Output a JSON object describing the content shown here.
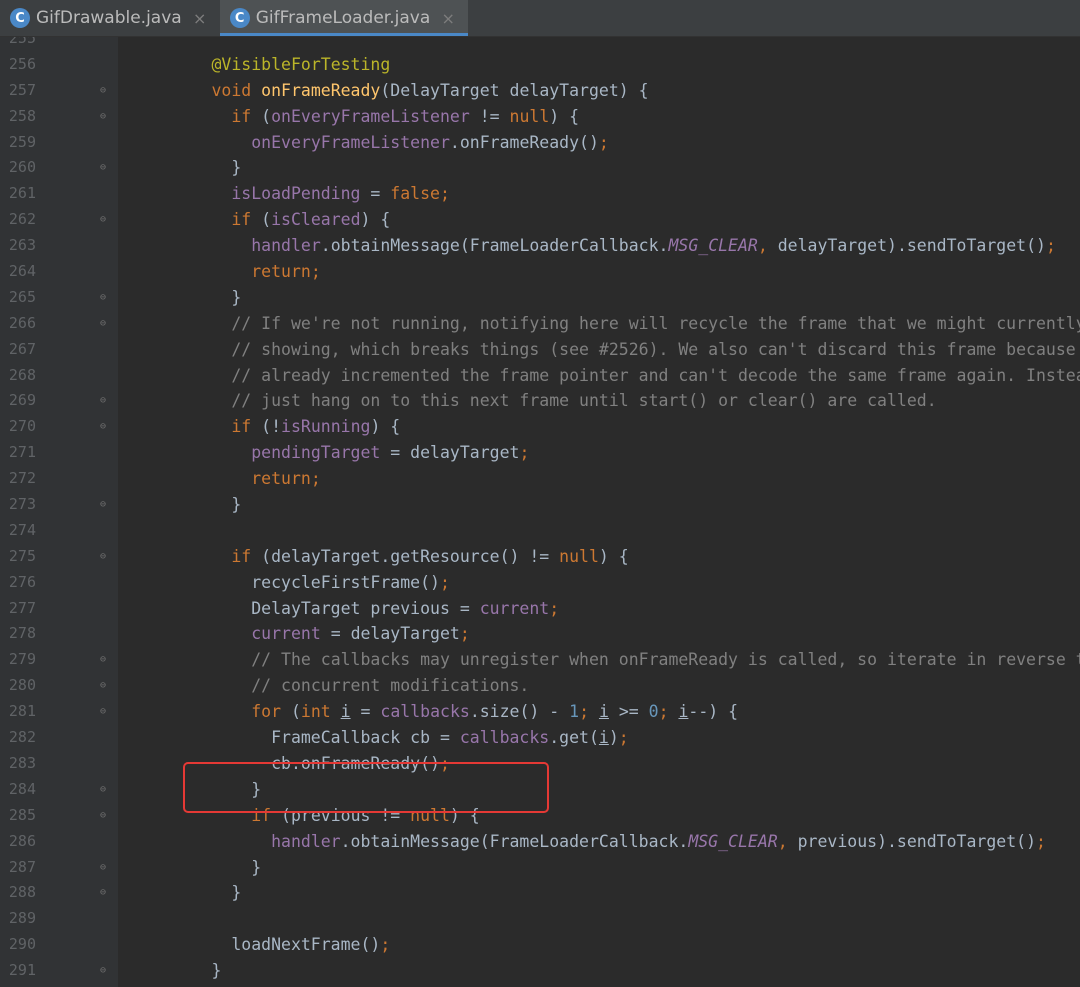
{
  "tabs": [
    {
      "label": "GifDrawable.java",
      "icon": "java-class-icon",
      "icon_glyph": "C",
      "active": false,
      "close": "×"
    },
    {
      "label": "GifFrameLoader.java",
      "icon": "java-class-icon",
      "icon_glyph": "C",
      "active": true,
      "close": "×"
    }
  ],
  "colors": {
    "background": "#2b2b2b",
    "gutter": "#313335",
    "keyword": "#cc7832",
    "annotation": "#bbb529",
    "method_declaration": "#ffc66d",
    "field": "#9876aa",
    "comment": "#808080",
    "number": "#6897bb",
    "highlight_box": "#e53935",
    "tab_accent": "#4a88c7"
  },
  "editor": {
    "lines": [
      {
        "n": "255",
        "fold": "",
        "tokens": []
      },
      {
        "n": "256",
        "fold": "",
        "tokens": [
          [
            "        ",
            ""
          ],
          [
            "@VisibleForTesting",
            "an"
          ]
        ]
      },
      {
        "n": "257",
        "fold": "⊖",
        "tokens": [
          [
            "        ",
            ""
          ],
          [
            "void ",
            "kw"
          ],
          [
            "onFrameReady",
            "fn"
          ],
          [
            "(DelayTarget delayTarget) {",
            ""
          ]
        ]
      },
      {
        "n": "258",
        "fold": "⊖",
        "tokens": [
          [
            "          ",
            ""
          ],
          [
            "if ",
            "kw"
          ],
          [
            "(",
            ""
          ],
          [
            "onEveryFrameListener",
            "fl"
          ],
          [
            " != ",
            ""
          ],
          [
            "null",
            "kw"
          ],
          [
            ") {",
            ""
          ]
        ]
      },
      {
        "n": "259",
        "fold": "",
        "tokens": [
          [
            "            ",
            ""
          ],
          [
            "onEveryFrameListener",
            "fl"
          ],
          [
            ".onFrameReady()",
            ""
          ],
          [
            ";",
            "kw"
          ]
        ]
      },
      {
        "n": "260",
        "fold": "⊖",
        "tokens": [
          [
            "          }",
            ""
          ]
        ]
      },
      {
        "n": "261",
        "fold": "",
        "tokens": [
          [
            "          ",
            ""
          ],
          [
            "isLoadPending",
            "fl"
          ],
          [
            " = ",
            ""
          ],
          [
            "false",
            "kw"
          ],
          [
            ";",
            "kw"
          ]
        ]
      },
      {
        "n": "262",
        "fold": "⊖",
        "tokens": [
          [
            "          ",
            ""
          ],
          [
            "if ",
            "kw"
          ],
          [
            "(",
            ""
          ],
          [
            "isCleared",
            "fl"
          ],
          [
            ") {",
            ""
          ]
        ]
      },
      {
        "n": "263",
        "fold": "",
        "tokens": [
          [
            "            ",
            ""
          ],
          [
            "handler",
            "fl"
          ],
          [
            ".obtainMessage(FrameLoaderCallback.",
            ""
          ],
          [
            "MSG_CLEAR",
            "st"
          ],
          [
            ", ",
            "kw"
          ],
          [
            "delayTarget).sendToTarget()",
            ""
          ],
          [
            ";",
            "kw"
          ]
        ]
      },
      {
        "n": "264",
        "fold": "",
        "tokens": [
          [
            "            ",
            ""
          ],
          [
            "return;",
            "kw"
          ]
        ]
      },
      {
        "n": "265",
        "fold": "⊖",
        "tokens": [
          [
            "          }",
            ""
          ]
        ]
      },
      {
        "n": "266",
        "fold": "⊖",
        "tokens": [
          [
            "          ",
            ""
          ],
          [
            "// If we're not running, notifying here will recycle the frame that we might currently be",
            "cm"
          ]
        ]
      },
      {
        "n": "267",
        "fold": "",
        "tokens": [
          [
            "          ",
            ""
          ],
          [
            "// showing, which breaks things (see #2526). We also can't discard this frame because we've",
            "cm"
          ]
        ]
      },
      {
        "n": "268",
        "fold": "",
        "tokens": [
          [
            "          ",
            ""
          ],
          [
            "// already incremented the frame pointer and can't decode the same frame again. Instead we'll",
            "cm"
          ]
        ]
      },
      {
        "n": "269",
        "fold": "⊖",
        "tokens": [
          [
            "          ",
            ""
          ],
          [
            "// just hang on to this next frame until start() or clear() are called.",
            "cm"
          ]
        ]
      },
      {
        "n": "270",
        "fold": "⊖",
        "tokens": [
          [
            "          ",
            ""
          ],
          [
            "if ",
            "kw"
          ],
          [
            "(!",
            ""
          ],
          [
            "isRunning",
            "fl"
          ],
          [
            ") {",
            ""
          ]
        ]
      },
      {
        "n": "271",
        "fold": "",
        "tokens": [
          [
            "            ",
            ""
          ],
          [
            "pendingTarget",
            "fl"
          ],
          [
            " = delayTarget",
            ""
          ],
          [
            ";",
            "kw"
          ]
        ]
      },
      {
        "n": "272",
        "fold": "",
        "tokens": [
          [
            "            ",
            ""
          ],
          [
            "return;",
            "kw"
          ]
        ]
      },
      {
        "n": "273",
        "fold": "⊖",
        "tokens": [
          [
            "          }",
            ""
          ]
        ]
      },
      {
        "n": "274",
        "fold": "",
        "tokens": []
      },
      {
        "n": "275",
        "fold": "⊖",
        "tokens": [
          [
            "          ",
            ""
          ],
          [
            "if ",
            "kw"
          ],
          [
            "(delayTarget.getResource() != ",
            ""
          ],
          [
            "null",
            "kw"
          ],
          [
            ") {",
            ""
          ]
        ]
      },
      {
        "n": "276",
        "fold": "",
        "tokens": [
          [
            "            recycleFirstFrame()",
            ""
          ],
          [
            ";",
            "kw"
          ]
        ]
      },
      {
        "n": "277",
        "fold": "",
        "tokens": [
          [
            "            DelayTarget previous = ",
            ""
          ],
          [
            "current",
            "fl"
          ],
          [
            ";",
            "kw"
          ]
        ]
      },
      {
        "n": "278",
        "fold": "",
        "tokens": [
          [
            "            ",
            ""
          ],
          [
            "current",
            "fl"
          ],
          [
            " = delayTarget",
            ""
          ],
          [
            ";",
            "kw"
          ]
        ]
      },
      {
        "n": "279",
        "fold": "⊖",
        "tokens": [
          [
            "            ",
            ""
          ],
          [
            "// The callbacks may unregister when onFrameReady is called, so iterate in reverse to avoid",
            "cm"
          ]
        ]
      },
      {
        "n": "280",
        "fold": "⊖",
        "tokens": [
          [
            "            ",
            ""
          ],
          [
            "// concurrent modifications.",
            "cm"
          ]
        ]
      },
      {
        "n": "281",
        "fold": "⊖",
        "tokens": [
          [
            "            ",
            ""
          ],
          [
            "for ",
            "kw"
          ],
          [
            "(",
            ""
          ],
          [
            "int ",
            "kw"
          ],
          [
            "i",
            "ul"
          ],
          [
            " = ",
            ""
          ],
          [
            "callbacks",
            "fl"
          ],
          [
            ".size() - ",
            ""
          ],
          [
            "1",
            "nm"
          ],
          [
            "; ",
            "kw"
          ],
          [
            "i",
            "ul"
          ],
          [
            " >= ",
            ""
          ],
          [
            "0",
            "nm"
          ],
          [
            "; ",
            "kw"
          ],
          [
            "i",
            "ul"
          ],
          [
            "--) {",
            ""
          ]
        ]
      },
      {
        "n": "282",
        "fold": "",
        "tokens": [
          [
            "              FrameCallback cb = ",
            ""
          ],
          [
            "callbacks",
            "fl"
          ],
          [
            ".get(",
            ""
          ],
          [
            "i",
            "ul"
          ],
          [
            ")",
            ""
          ],
          [
            ";",
            "kw"
          ]
        ]
      },
      {
        "n": "283",
        "fold": "",
        "tokens": [
          [
            "              cb.onFrameReady()",
            ""
          ],
          [
            ";",
            "kw"
          ]
        ]
      },
      {
        "n": "284",
        "fold": "⊖",
        "tokens": [
          [
            "            }",
            ""
          ]
        ]
      },
      {
        "n": "285",
        "fold": "⊖",
        "tokens": [
          [
            "            ",
            ""
          ],
          [
            "if ",
            "kw"
          ],
          [
            "(previous != ",
            ""
          ],
          [
            "null",
            "kw"
          ],
          [
            ") {",
            ""
          ]
        ]
      },
      {
        "n": "286",
        "fold": "",
        "tokens": [
          [
            "              ",
            ""
          ],
          [
            "handler",
            "fl"
          ],
          [
            ".obtainMessage(FrameLoaderCallback.",
            ""
          ],
          [
            "MSG_CLEAR",
            "st"
          ],
          [
            ", ",
            "kw"
          ],
          [
            "previous).sendToTarget()",
            ""
          ],
          [
            ";",
            "kw"
          ]
        ]
      },
      {
        "n": "287",
        "fold": "⊖",
        "tokens": [
          [
            "            }",
            ""
          ]
        ]
      },
      {
        "n": "288",
        "fold": "⊖",
        "tokens": [
          [
            "          }",
            ""
          ]
        ]
      },
      {
        "n": "289",
        "fold": "",
        "tokens": []
      },
      {
        "n": "290",
        "fold": "",
        "tokens": [
          [
            "          loadNextFrame()",
            ""
          ],
          [
            ";",
            "kw"
          ]
        ]
      },
      {
        "n": "291",
        "fold": "⊖",
        "tokens": [
          [
            "        }",
            ""
          ]
        ]
      }
    ]
  }
}
